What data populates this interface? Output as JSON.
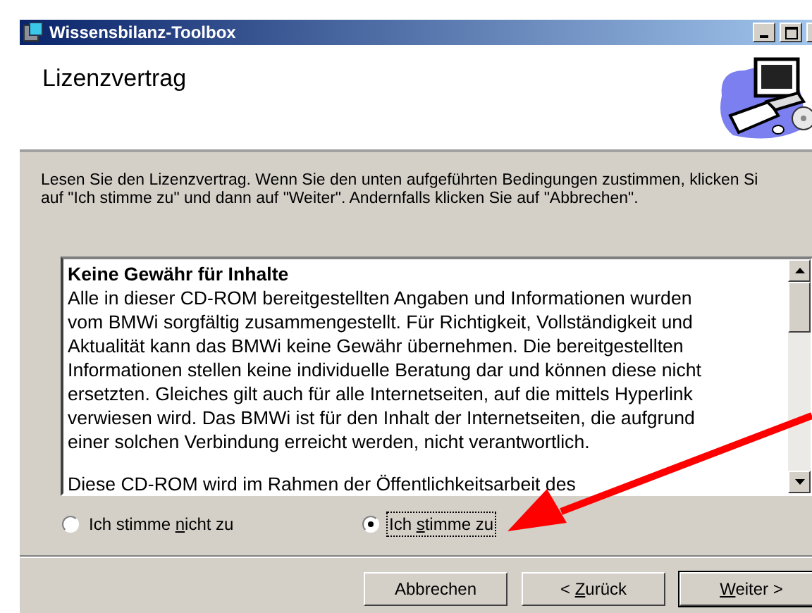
{
  "window": {
    "title": "Wissensbilanz-Toolbox"
  },
  "header": {
    "title": "Lizenzvertrag"
  },
  "intro": [
    "Lesen Sie den Lizenzvertrag. Wenn Sie den unten aufgeführten Bedingungen zustimmen, klicken Si",
    "auf  \"Ich stimme zu\" und dann auf \"Weiter\". Andernfalls klicken Sie auf \"Abbrechen\"."
  ],
  "license": {
    "heading": "Keine Gewähr für Inhalte",
    "lines": [
      "Alle in dieser CD-ROM bereitgestellten Angaben und Informationen wurden",
      "vom BMWi sorgfältig zusammengestellt. Für Richtigkeit, Vollständigkeit und",
      "Aktualität kann das BMWi keine Gewähr übernehmen. Die bereitgestellten",
      "Informationen stellen keine individuelle Beratung dar und können diese nicht",
      "ersetzten. Gleiches gilt auch für alle Internetseiten, auf die mittels Hyperlink",
      "verwiesen wird. Das BMWi ist für den Inhalt der Internetseiten, die aufgrund",
      "einer solchen Verbindung erreicht werden, nicht verantwortlich."
    ],
    "next": "Diese CD-ROM wird im Rahmen der Öffentlichkeitsarbeit des"
  },
  "options": [
    {
      "pre": "Ich stimme ",
      "key": "n",
      "post": "icht zu",
      "selected": false,
      "focused": false
    },
    {
      "pre": "Ich ",
      "key": "s",
      "post": "timme zu",
      "selected": true,
      "focused": true
    }
  ],
  "buttons": [
    {
      "pre": "Abbrechen",
      "default": false
    },
    {
      "pre": "< ",
      "key": "Z",
      "post": "urück",
      "default": false
    },
    {
      "key": "W",
      "post": "eiter >",
      "default": true
    }
  ]
}
